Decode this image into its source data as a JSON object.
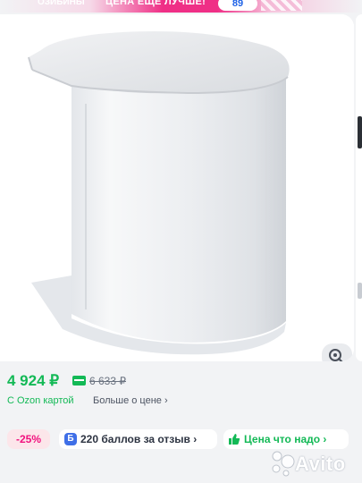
{
  "banner": {
    "left_text": "ОЗИБИНЫ",
    "headline": "ЦЕНА ЕЩЁ ЛУЧШЕ!",
    "badge": "89"
  },
  "product": {
    "price": "4 924 ₽",
    "old_price": "6 633 ₽",
    "ozon_card_label": "С Ozon картой",
    "more_about_price": "Больше о цене ›"
  },
  "chips": {
    "discount": "-25%",
    "bonus_icon": "Б",
    "bonus": "220 баллов за отзыв ›",
    "good_price": "Цена что надо ›"
  },
  "watermark": {
    "text": "Avito"
  },
  "colors": {
    "price_green": "#13b956",
    "discount_pink": "#f1117e",
    "bonus_blue": "#3f6fe7"
  }
}
